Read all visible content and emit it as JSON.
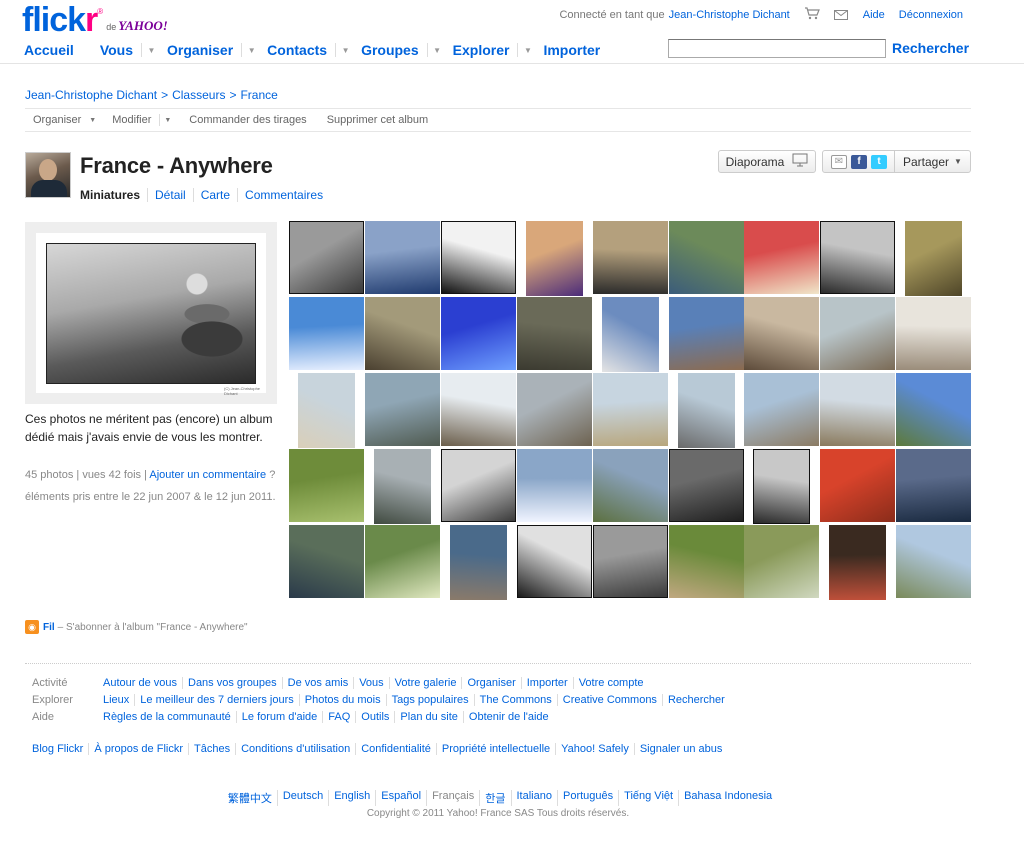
{
  "header": {
    "logo": {
      "flick": "flick",
      "r": "r",
      "reg": "®",
      "de": "de",
      "yahoo": "YAHOO!"
    },
    "connected_label": "Connecté en tant que",
    "user_name": "Jean-Christophe Dichant",
    "help": "Aide",
    "logout": "Déconnexion",
    "nav": [
      "Accueil",
      "Vous",
      "Organiser",
      "Contacts",
      "Groupes",
      "Explorer",
      "Importer"
    ],
    "search_button": "Rechercher",
    "search_value": ""
  },
  "breadcrumb": [
    "Jean-Christophe Dichant",
    "Classeurs",
    "France"
  ],
  "breadcrumb_sep": ">",
  "toolbar": {
    "organize": "Organiser",
    "modify": "Modifier",
    "order_prints": "Commander des tirages",
    "delete_album": "Supprimer cet album"
  },
  "album": {
    "title": "France - Anywhere",
    "tabs": [
      "Miniatures",
      "Détail",
      "Carte",
      "Commentaires"
    ],
    "active_tab": "Miniatures",
    "slideshow": "Diaporama",
    "share": "Partager",
    "cover_caption": "(C) Jean-Christophe Dichant",
    "description": "Ces photos ne méritent pas (encore) un album dédié mais j'avais envie de vous les montrer.",
    "stats_photos": "45 photos",
    "stats_views": "vues 42 fois",
    "add_comment": "Ajouter un commentaire",
    "help_q": "?",
    "dates": "éléments pris entre le 22 jun 2007 & le 12 jun 2011."
  },
  "photos": [
    {
      "c1": "#9a9a9a",
      "c2": "#3a3a3a",
      "bw": true
    },
    {
      "c1": "#8aa2c8",
      "c2": "#1f3a6e"
    },
    {
      "c1": "#f2f2f2",
      "c2": "#111111",
      "bw": true
    },
    {
      "c1": "#d9a77a",
      "c2": "#4b2b7a"
    },
    {
      "c1": "#b4a07d",
      "c2": "#2a2a2a"
    },
    {
      "c1": "#6c8a5a",
      "c2": "#3b5c7a"
    },
    {
      "c1": "#d94c4c",
      "c2": "#f0e6c9"
    },
    {
      "c1": "#c4c4c4",
      "c2": "#2b2b2b",
      "bw": true
    },
    {
      "c1": "#a6985c",
      "c2": "#4e4528"
    },
    {
      "c1": "#4a8ad6",
      "c2": "#e8f0ff"
    },
    {
      "c1": "#a39a7a",
      "c2": "#4a4030"
    },
    {
      "c1": "#2b3fd1",
      "c2": "#6fa0ff"
    },
    {
      "c1": "#6a6a58",
      "c2": "#3b3a30"
    },
    {
      "c1": "#6c8cbf",
      "c2": "#e4e4e4"
    },
    {
      "c1": "#5980b8",
      "c2": "#8c6b4f"
    },
    {
      "c1": "#c9b8a0",
      "c2": "#5d4b3a"
    },
    {
      "c1": "#b8c4c8",
      "c2": "#7a6a55"
    },
    {
      "c1": "#e8e4dc",
      "c2": "#9a8c7a"
    },
    {
      "c1": "#c8d4dc",
      "c2": "#d9cfb9"
    },
    {
      "c1": "#8fa6b5",
      "c2": "#4f5a50"
    },
    {
      "c1": "#e7ecf0",
      "c2": "#6a5d4a"
    },
    {
      "c1": "#aab2b8",
      "c2": "#6d6250"
    },
    {
      "c1": "#c7d5e0",
      "c2": "#b8a67c"
    },
    {
      "c1": "#b8c9d6",
      "c2": "#6a6a6a"
    },
    {
      "c1": "#a9c0d6",
      "c2": "#8b7a62"
    },
    {
      "c1": "#d2dbe3",
      "c2": "#8a7a5d"
    },
    {
      "c1": "#5b8bd6",
      "c2": "#5d7a3a"
    },
    {
      "c1": "#6e8c3a",
      "c2": "#a8c06e"
    },
    {
      "c1": "#a8b0b4",
      "c2": "#404a40"
    },
    {
      "c1": "#d4d4d4",
      "c2": "#3a3a3a",
      "bw": true
    },
    {
      "c1": "#8aa6c8",
      "c2": "#f0f4ff"
    },
    {
      "c1": "#8aa2bc",
      "c2": "#5c7040"
    },
    {
      "c1": "#6a6a6a",
      "c2": "#1f1f1f",
      "bw": true
    },
    {
      "c1": "#c8c8c8",
      "c2": "#2a2a2a",
      "bw": true
    },
    {
      "c1": "#d8432b",
      "c2": "#8a2c1a"
    },
    {
      "c1": "#5a6a8a",
      "c2": "#1a2a40"
    },
    {
      "c1": "#5a6e5a",
      "c2": "#2a3a4a"
    },
    {
      "c1": "#6a8a4a",
      "c2": "#e0e8c0"
    },
    {
      "c1": "#4a6a8a",
      "c2": "#8a7a6a"
    },
    {
      "c1": "#e0e0e0",
      "c2": "#1a1a1a",
      "bw": true
    },
    {
      "c1": "#9a9a9a",
      "c2": "#3a3a3a",
      "bw": true
    },
    {
      "c1": "#6a8a3a",
      "c2": "#c0a880"
    },
    {
      "c1": "#8a9a5a",
      "c2": "#d0d8c0"
    },
    {
      "c1": "#3a2a20",
      "c2": "#c0503a"
    },
    {
      "c1": "#b0c8e0",
      "c2": "#7a8a5a"
    }
  ],
  "feed": {
    "label": "Fil",
    "text": "– S'abonner à l'album \"France - Anywhere\""
  },
  "footer": {
    "rows": [
      {
        "head": "Activité",
        "items": [
          "Autour de vous",
          "Dans vos groupes",
          "De vos amis",
          "Vous",
          "Votre galerie",
          "Organiser",
          "Importer",
          "Votre compte"
        ]
      },
      {
        "head": "Explorer",
        "items": [
          "Lieux",
          "Le meilleur des 7 derniers jours",
          "Photos du mois",
          "Tags populaires",
          "The Commons",
          "Creative Commons",
          "Rechercher"
        ]
      },
      {
        "head": "Aide",
        "items": [
          "Règles de la communauté",
          "Le forum d'aide",
          "FAQ",
          "Outils",
          "Plan du site",
          "Obtenir de l'aide"
        ]
      }
    ],
    "links": [
      "Blog Flickr",
      "À propos de Flickr",
      "Tâches",
      "Conditions d'utilisation",
      "Confidentialité",
      "Propriété intellectuelle",
      "Yahoo! Safely",
      "Signaler un abus"
    ],
    "languages": [
      "繁體中文",
      "Deutsch",
      "English",
      "Español",
      "Français",
      "한글",
      "Italiano",
      "Português",
      "Tiếng Việt",
      "Bahasa Indonesia"
    ],
    "current_language": "Français",
    "copyright": "Copyright © 2011 Yahoo! France SAS Tous droits réservés."
  },
  "colors": {
    "link": "#0063dc",
    "pink": "#ff0084",
    "yahoo": "#7b0099"
  }
}
